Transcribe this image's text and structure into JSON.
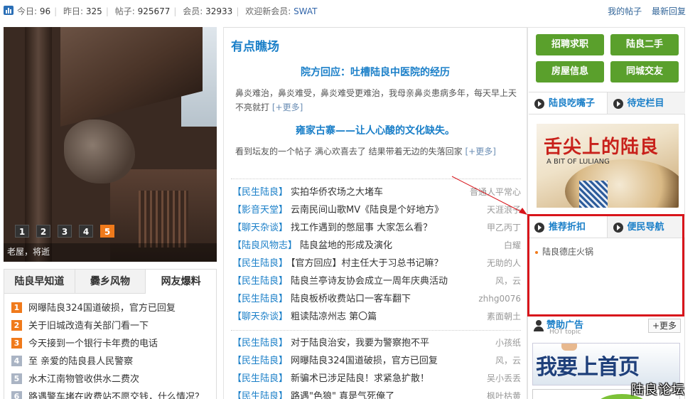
{
  "topbar": {
    "stats": [
      {
        "label": "今日:",
        "value": "96"
      },
      {
        "label": "昨日:",
        "value": "325"
      },
      {
        "label": "帖子:",
        "value": "925677"
      },
      {
        "label": "会员:",
        "value": "32933"
      }
    ],
    "welcome_label": "欢迎新会员:",
    "new_member": "SWAT",
    "links": [
      "我的帖子",
      "最新回复"
    ]
  },
  "slideshow": {
    "caption": "老屋，将逝",
    "pages": [
      "1",
      "2",
      "3",
      "4",
      "5"
    ],
    "active_page": 5
  },
  "left_tabs": {
    "tabs": [
      "陆良早知道",
      "爨乡风物",
      "网友爆料"
    ],
    "active_tab": 2,
    "items": [
      {
        "rank": "1",
        "hot": true,
        "title": "网曝陆良324国道破损，官方已回复"
      },
      {
        "rank": "2",
        "hot": true,
        "title": "关于旧城改造有关部门看一下"
      },
      {
        "rank": "3",
        "hot": true,
        "title": "今天接到一个银行卡年费的电话"
      },
      {
        "rank": "4",
        "hot": false,
        "title": "至 亲爱的陆良县人民警察"
      },
      {
        "rank": "5",
        "hot": false,
        "title": "水木江南物管收供水二费次"
      },
      {
        "rank": "6",
        "hot": false,
        "title": "路遇警车堵在收费站不愿交钱，什么情况？"
      }
    ]
  },
  "middle": {
    "section_title": "有点瞧场",
    "featured": [
      {
        "headline": "院方回应：吐槽陆良中医院的经历",
        "summary": "鼻炎难治，鼻炎难受，鼻炎难受更难治，我母亲鼻炎患病多年，每天早上天不亮就打",
        "more": "[+更多]"
      },
      {
        "headline": "雍家古寨——让人心酸的文化缺失。",
        "summary": "看到坛友的一个帖子 满心欢喜去了 结果带着无边的失落回家",
        "more": "[+更多]"
      }
    ],
    "posts_group1": [
      {
        "cat": "【民生陆良】",
        "title": "实拍华侨农场之大堵车",
        "author": "普通人平常心"
      },
      {
        "cat": "【影音天堂】",
        "title": "云南民间山歌MV《陆良是个好地方》",
        "author": "天涯浪子"
      },
      {
        "cat": "【聊天杂谈】",
        "title": "找工作遇到的憋屈事 大家怎么看？",
        "author": "甲乙丙丁"
      },
      {
        "cat": "【陆良风物志】",
        "title": "陆良盆地的形成及演化",
        "author": "白耀"
      },
      {
        "cat": "【民生陆良】",
        "title": "【官方回应】村主任大于习总书记嘛？",
        "author": "无助的人"
      },
      {
        "cat": "【民生陆良】",
        "title": "陆良兰亭诗友协会成立一周年庆典活动",
        "author": "风，云"
      },
      {
        "cat": "【民生陆良】",
        "title": "陆良板桥收费站口一客车翻下",
        "author": "zhhg0076"
      },
      {
        "cat": "【聊天杂谈】",
        "title": "粗读陆凉州志 第〇篇",
        "author": "素面朝土"
      }
    ],
    "posts_group2": [
      {
        "cat": "【民生陆良】",
        "title": "对于陆良治安，我要为警察抱不平",
        "author": "小孩纸"
      },
      {
        "cat": "【民生陆良】",
        "title": "网曝陆良324国道破损，官方已回复",
        "author": "风，云"
      },
      {
        "cat": "【民生陆良】",
        "title": "新骗术已涉足陆良！求紧急扩散！",
        "author": "吴小丢丢"
      },
      {
        "cat": "【民生陆良】",
        "title": "路遇\"色狼\" 真是气死俺了",
        "author": "枫叶枯黄"
      }
    ]
  },
  "right": {
    "buttons": [
      "招聘求职",
      "陆良二手",
      "房屋信息",
      "同城交友"
    ],
    "food_tabs": [
      "陆良吃嘴子",
      "待定栏目"
    ],
    "food_image": {
      "title": "舌尖上的陆良",
      "subtitle": "A BIT OF LULIANG"
    },
    "deal_tabs": [
      "推荐折扣",
      "便民导航"
    ],
    "deals": [
      "陆良德庄火锅"
    ],
    "ad": {
      "title": "赞助广告",
      "subtitle": "HOT topic",
      "more": "+更多",
      "banner_text": "我要上首页"
    }
  },
  "watermark": "陆良论坛",
  "colors": {
    "accent_blue": "#1a7fc8",
    "accent_orange": "#f07a1b",
    "button_green": "#5aa02c",
    "annotation_red": "#d8151b"
  }
}
